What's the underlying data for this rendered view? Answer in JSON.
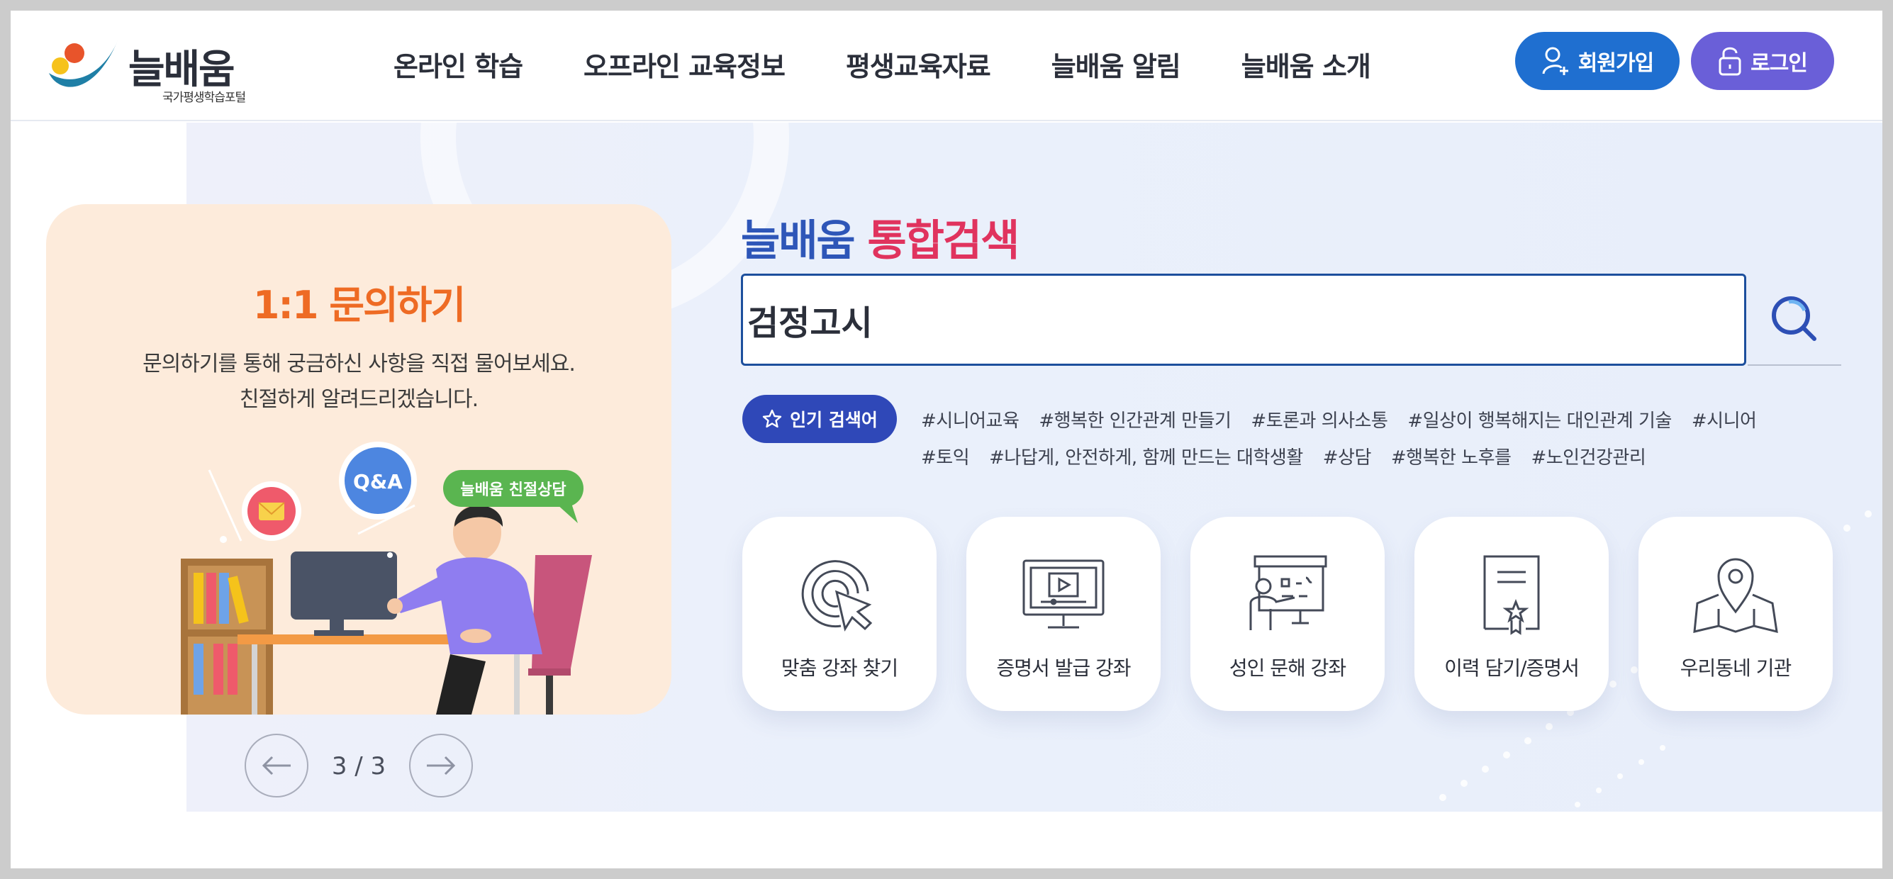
{
  "header": {
    "logo_title": "늘배움",
    "logo_sub": "국가평생학습포털",
    "nav": [
      "온라인 학습",
      "오프라인 교육정보",
      "평생교육자료",
      "늘배움 알림",
      "늘배움 소개"
    ],
    "join_label": "회원가입",
    "login_label": "로그인"
  },
  "banner": {
    "title": "1:1 문의하기",
    "desc1": "문의하기를 통해 궁금하신 사항을 직접 물어보세요.",
    "desc2": "친절하게 알려드리겠습니다.",
    "bubble_qa": "Q&A",
    "bubble_chat": "늘배움 친절상담",
    "background_color": "#fdebdb",
    "title_color": "#ee6b24"
  },
  "pager": {
    "count": "3 / 3"
  },
  "search": {
    "title_part1": "늘배움",
    "title_part2": "통합검색",
    "value": "검정고시",
    "popular_label": "인기 검색어",
    "tags_row1": [
      "#시니어교육",
      "#행복한 인간관계 만들기",
      "#토론과 의사소통",
      "#일상이 행복해지는 대인관계 기술",
      "#시니어"
    ],
    "tags_row2": [
      "#토익",
      "#나답게, 안전하게, 함께 만드는 대학생활",
      "#상담",
      "#행복한 노후를",
      "#노인건강관리"
    ]
  },
  "quick_menu": [
    {
      "label": "맞춤 강좌 찾기",
      "icon": "target-cursor-icon"
    },
    {
      "label": "증명서 발급 강좌",
      "icon": "monitor-play-icon"
    },
    {
      "label": "성인 문해 강좌",
      "icon": "teacher-board-icon"
    },
    {
      "label": "이력 담기/증명서",
      "icon": "certificate-document-icon"
    },
    {
      "label": "우리동네 기관",
      "icon": "map-pin-icon"
    }
  ],
  "colors": {
    "brand_blue": "#1f6fd0",
    "brand_purple": "#6a5fd8",
    "search_title_blue": "#2e56b8",
    "search_title_red": "#e0335e",
    "popular_label_bg": "#2f48b8"
  }
}
